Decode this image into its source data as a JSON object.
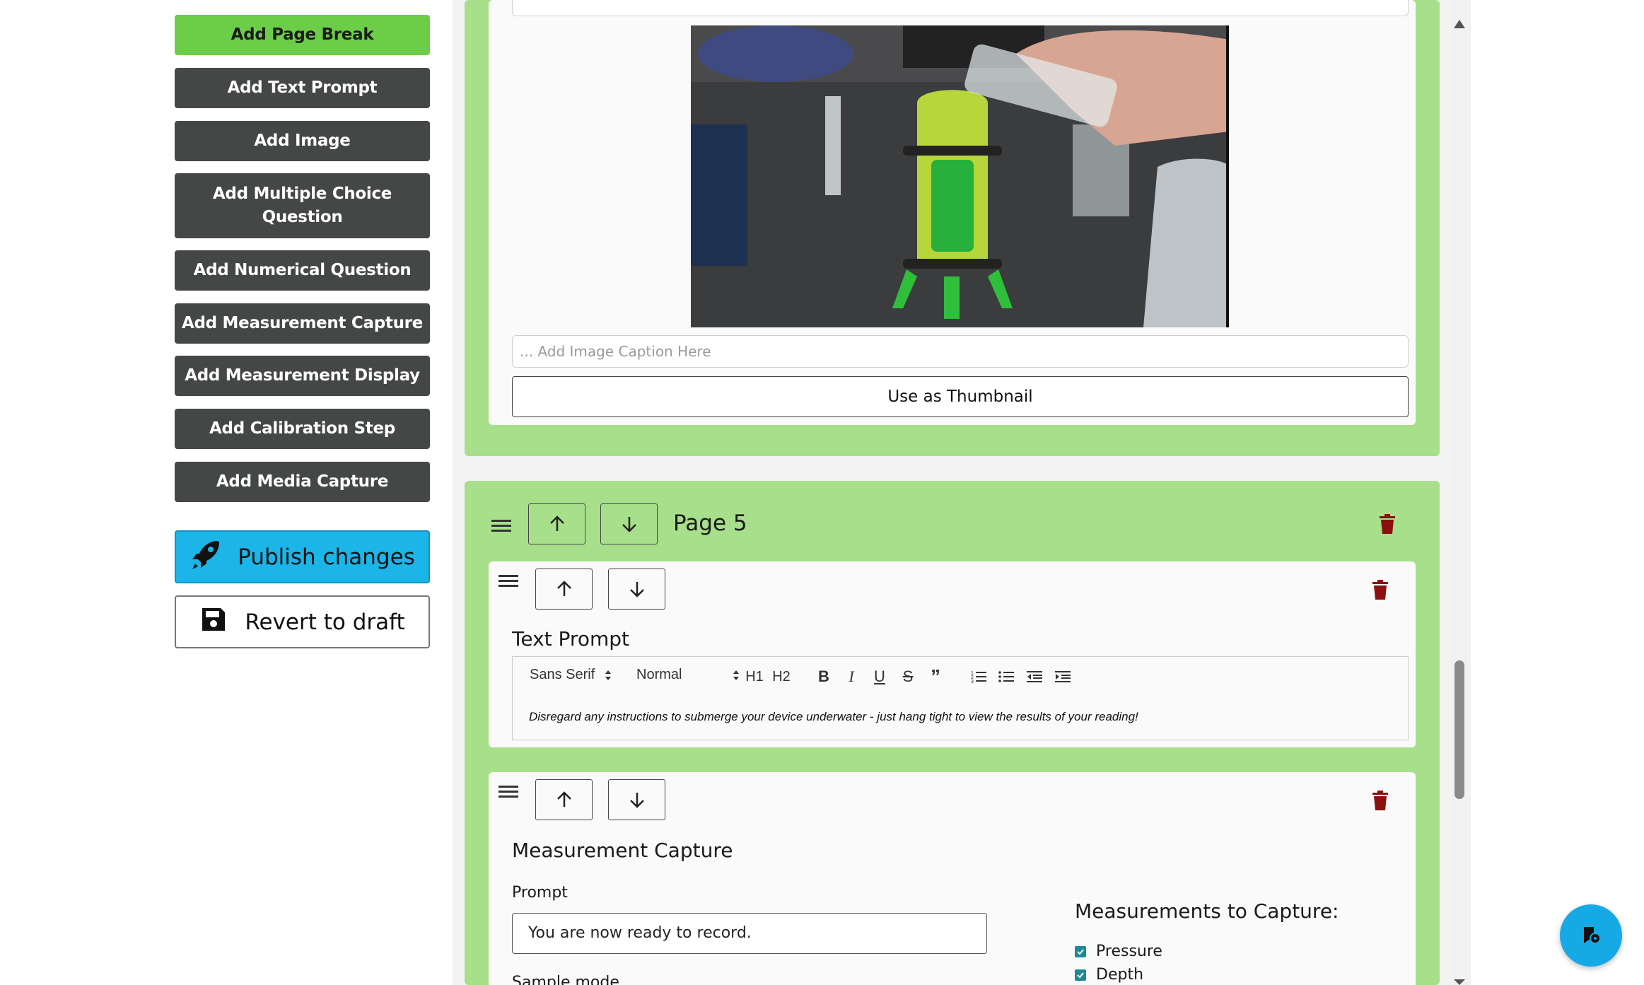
{
  "sidebar": {
    "buttons": [
      {
        "label": "Add Page Break"
      },
      {
        "label": "Add Text Prompt"
      },
      {
        "label": "Add Image"
      },
      {
        "label": "Add Multiple Choice Question"
      },
      {
        "label": "Add Numerical Question"
      },
      {
        "label": "Add Measurement Capture"
      },
      {
        "label": "Add Measurement Display"
      },
      {
        "label": "Add Calibration Step"
      },
      {
        "label": "Add Media Capture"
      }
    ],
    "publish_label": "Publish changes",
    "revert_label": "Revert to draft"
  },
  "image_card": {
    "caption_placeholder": "... Add Image Caption Here",
    "thumbnail_button": "Use as Thumbnail"
  },
  "page": {
    "title": "Page 5"
  },
  "text_prompt_card": {
    "title": "Text Prompt",
    "font_select": "Sans Serif",
    "size_select": "Normal",
    "h1_label": "H1",
    "h2_label": "H2",
    "body_text": "Disregard any instructions to submerge your device underwater - just hang tight to view the results of your reading!"
  },
  "measurement_card": {
    "title": "Measurement Capture",
    "prompt_label": "Prompt",
    "prompt_value": "You are now ready to record.",
    "sample_mode_label": "Sample mode",
    "measurements_title": "Measurements to Capture:",
    "measurements": [
      {
        "label": "Pressure",
        "checked": true
      },
      {
        "label": "Depth",
        "checked": true
      }
    ]
  },
  "colors": {
    "page_green": "#a7df8b",
    "button_green": "#6cce48",
    "button_dark": "#444746",
    "publish_blue": "#1cb5e8",
    "trash_red": "#8b1010"
  }
}
